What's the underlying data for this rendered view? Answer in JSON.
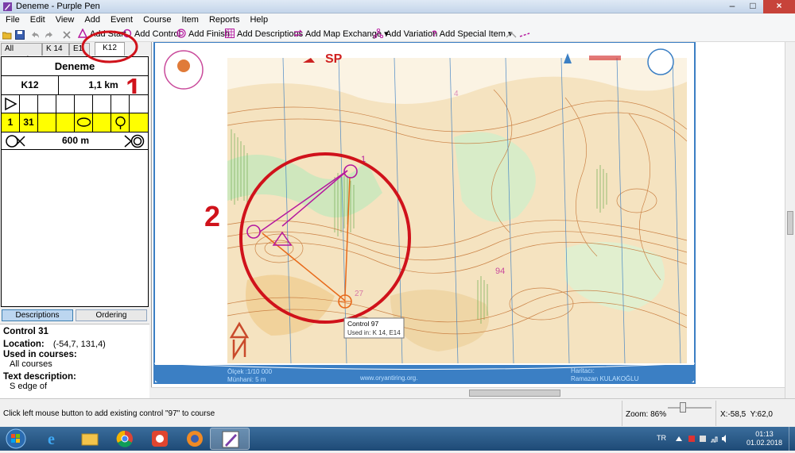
{
  "window": {
    "title": "Deneme - Purple Pen"
  },
  "menu": [
    "File",
    "Edit",
    "View",
    "Add",
    "Event",
    "Course",
    "Item",
    "Reports",
    "Help"
  ],
  "toolbar": {
    "add_start": "Add Start",
    "add_control": "Add Control",
    "add_finish": "Add Finish",
    "add_descriptions": "Add Descriptions",
    "add_map_exchange": "Add Map Exchange",
    "add_variation": "Add Variation",
    "add_special_item": "Add Special Item"
  },
  "tabs": [
    "All controls",
    "K 14",
    "E1",
    "K12"
  ],
  "description": {
    "event": "Deneme",
    "course": "K12",
    "length": "1,1 km",
    "row": {
      "num": "1",
      "code": "31"
    },
    "finish_distance": "600 m"
  },
  "left_buttons": {
    "descriptions": "Descriptions",
    "ordering": "Ordering"
  },
  "properties": {
    "heading": "Control 31",
    "location_label": "Location:",
    "location_value": "(-54,7, 131,4)",
    "used_label": "Used in courses:",
    "used_value": "All courses",
    "text_label": "Text description:",
    "text_value": "S edge of"
  },
  "map": {
    "tooltip_title": "Control 97",
    "tooltip_sub": "Used in: K 14, E14",
    "footer_scale": "Ölçek :1/10 000",
    "footer_contour": "Münhani: 5 m",
    "footer_url": "www.oryantiring.org.",
    "footer_mapper_label": "Haritacı:",
    "footer_mapper": "Ramazan KULAKOĞLU",
    "annotation_1": "1",
    "annotation_2": "2",
    "control_num_1": "1",
    "control_num_4": "4",
    "label_94": "94",
    "label_27": "27",
    "title_fragment": "SP"
  },
  "status": {
    "message": "Click left mouse button to add existing control \"97\" to course",
    "zoom": "Zoom: 86%",
    "coords": "X:-58,5  Y:62,0"
  },
  "taskbar": {
    "lang": "TR",
    "time": "01:13",
    "date": "01.02.2018"
  },
  "colors": {
    "course_purple": "#b5179e",
    "annotation_red": "#d0121b",
    "highlight_yellow": "#ffff00",
    "map_blue": "#3b7fc4"
  }
}
